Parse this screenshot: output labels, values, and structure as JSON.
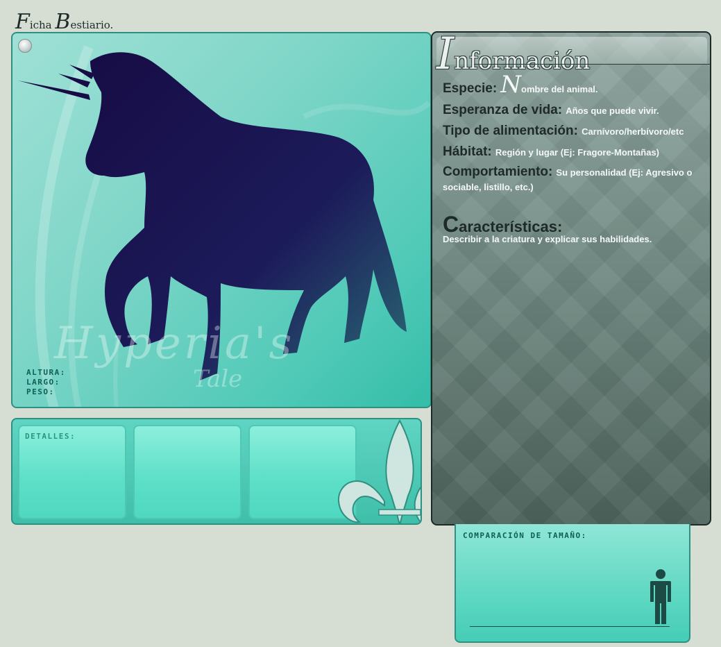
{
  "page": {
    "title_initial": "F",
    "title_rest": "icha ",
    "title_initial2": "B",
    "title_rest2": "estiario."
  },
  "image_panel": {
    "watermark": "Hyperia's",
    "watermark_sub": "Tale",
    "measures": {
      "height_label": "ALTURA:",
      "length_label": "LARGO:",
      "weight_label": "PESO:"
    }
  },
  "details": {
    "label": "DETALLES:"
  },
  "info": {
    "title_initial": "I",
    "title_rest": "nformación",
    "fields": [
      {
        "label": "Especie:",
        "fancy_initial": "N",
        "value": "ombre del animal."
      },
      {
        "label": "Esperanza de vida:",
        "value": "Años que puede vivir."
      },
      {
        "label": "Tipo de alimentación:",
        "value": "Carnívoro/herbívoro/etc"
      },
      {
        "label": "Hábitat:",
        "value": "Región y lugar (Ej: Fragore-Montañas)"
      },
      {
        "label": "Comportamiento:",
        "value": "Su personalidad (Ej: Agresivo o sociable, listillo, etc.)"
      }
    ],
    "characteristics": {
      "title_initial": "C",
      "title_rest": "aracterísticas:",
      "description": "Describir a la criatura y explicar sus habilidades."
    }
  },
  "size_comparison": {
    "label": "COMPARACIÓN DE TAMAÑO:"
  },
  "colors": {
    "background": "#d6ded4",
    "teal_panel": "#4fc9b7",
    "silhouette": "#1a1048",
    "info_panel": "#6f8a83"
  },
  "icons": [
    "panel-knob-icon",
    "fleur-de-lis-icon",
    "person-icon"
  ]
}
